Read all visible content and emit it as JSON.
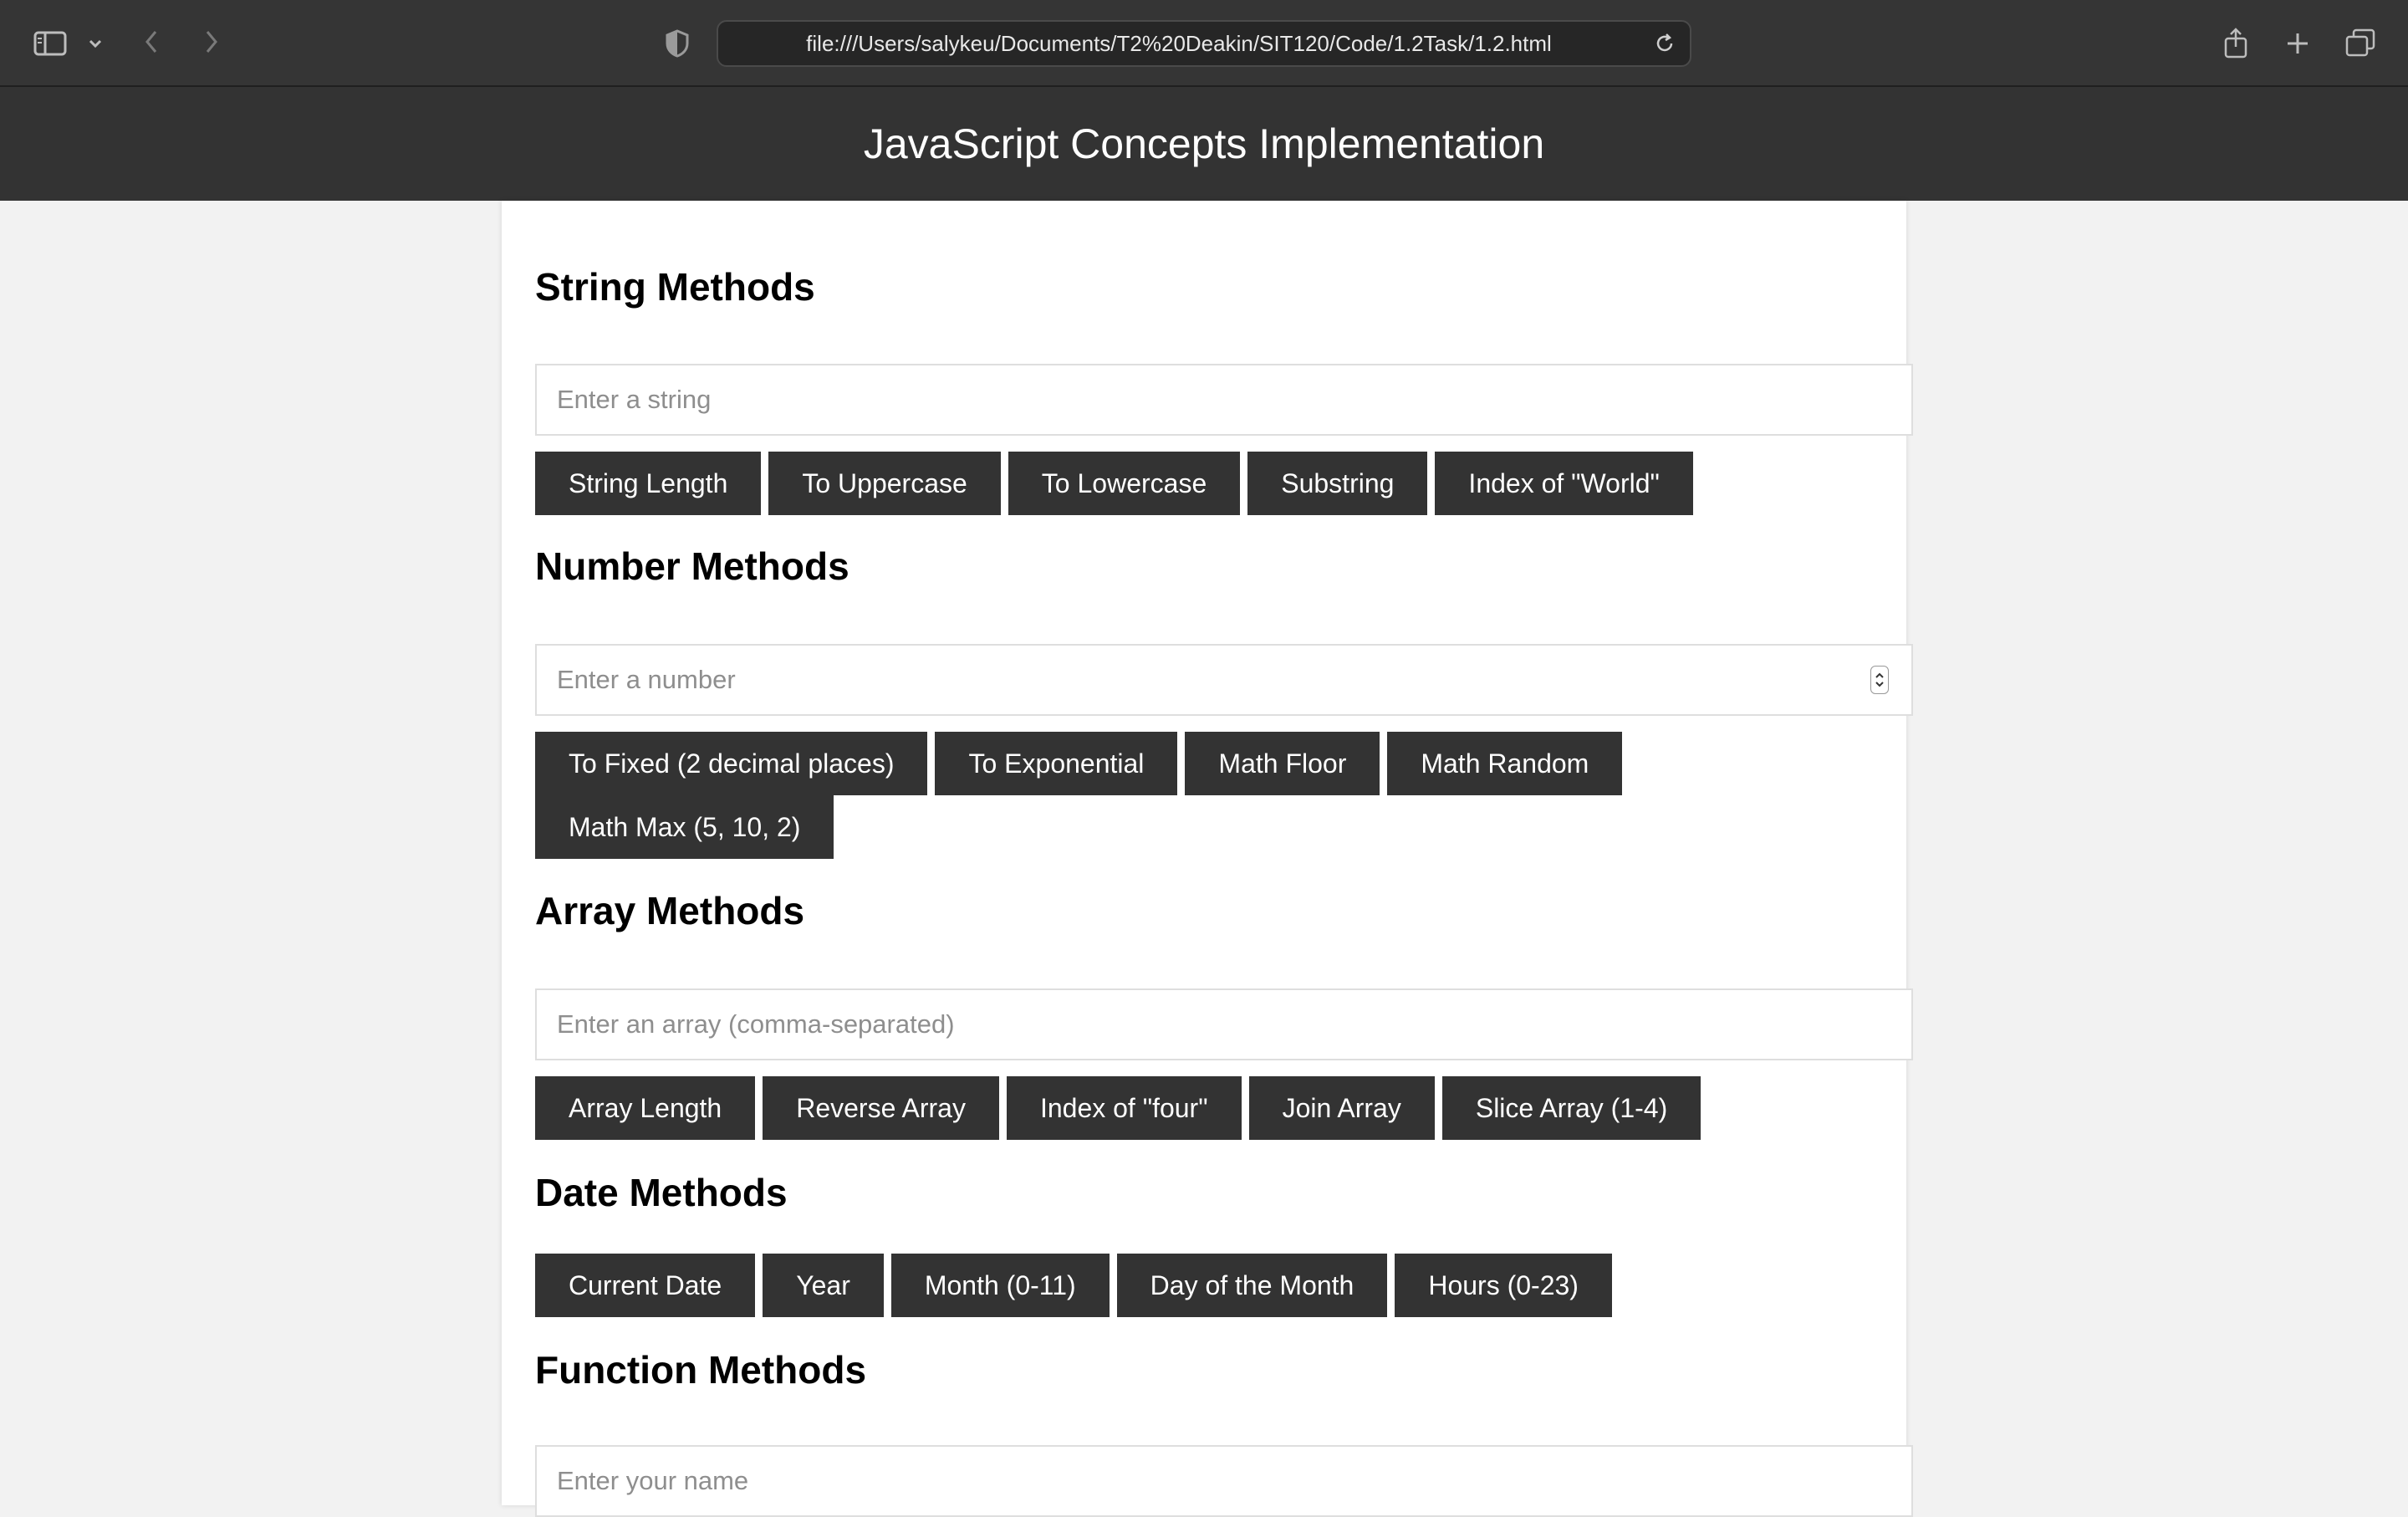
{
  "browser": {
    "url": "file:///Users/salykeu/Documents/T2%20Deakin/SIT120/Code/1.2Task/1.2.html",
    "icons": [
      "sidebar-icon",
      "chevron-down-icon",
      "back-icon",
      "forward-icon",
      "shield-icon",
      "reload-icon",
      "share-icon",
      "new-tab-icon",
      "tabs-overview-icon"
    ]
  },
  "page": {
    "title": "JavaScript Concepts Implementation"
  },
  "sections": {
    "string": {
      "title": "String Methods",
      "placeholder": "Enter a string",
      "buttons": [
        "String Length",
        "To Uppercase",
        "To Lowercase",
        "Substring",
        "Index of \"World\""
      ]
    },
    "number": {
      "title": "Number Methods",
      "placeholder": "Enter a number",
      "buttons": [
        "To Fixed (2 decimal places)",
        "To Exponential",
        "Math Floor",
        "Math Random",
        "Math Max (5, 10, 2)"
      ]
    },
    "array": {
      "title": "Array Methods",
      "placeholder": "Enter an array (comma-separated)",
      "buttons": [
        "Array Length",
        "Reverse Array",
        "Index of \"four\"",
        "Join Array",
        "Slice Array (1-4)"
      ]
    },
    "date": {
      "title": "Date Methods",
      "buttons": [
        "Current Date",
        "Year",
        "Month (0-11)",
        "Day of the Month",
        "Hours (0-23)"
      ]
    },
    "function": {
      "title": "Function Methods",
      "placeholder": "Enter your name"
    }
  },
  "colors": {
    "chrome": "#353535",
    "header": "#333333",
    "button": "#333333",
    "background": "#f2f2f2",
    "card": "#ffffff"
  }
}
